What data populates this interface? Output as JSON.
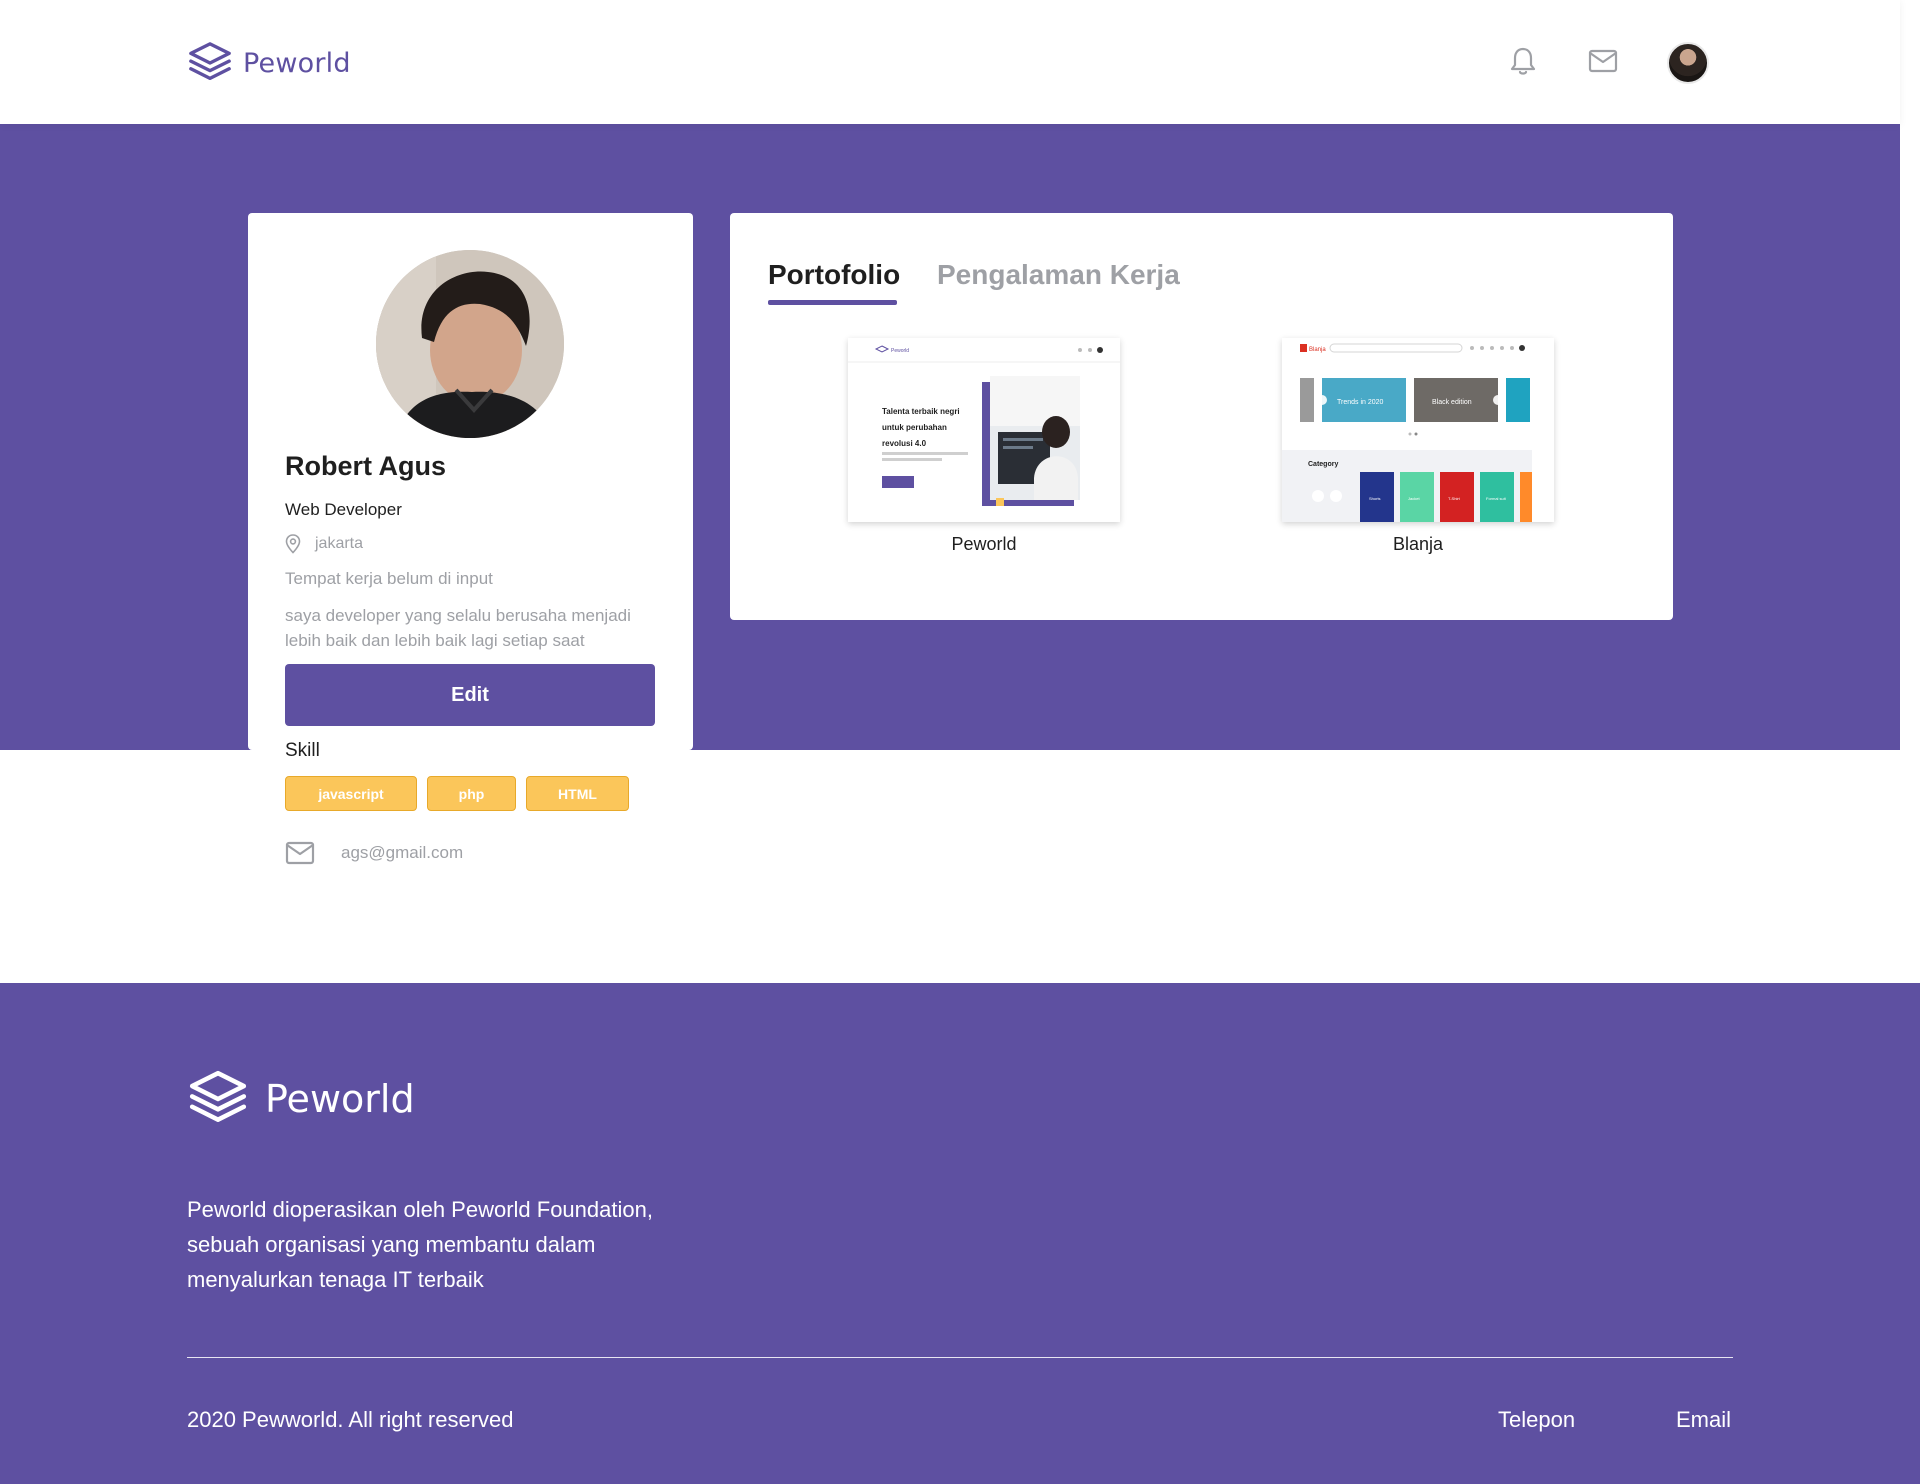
{
  "nav": {
    "brand": "Peworld",
    "icons": [
      "bell-icon",
      "mail-icon"
    ]
  },
  "profile": {
    "name": "Robert Agus",
    "job": "Web Developer",
    "location": "jakarta",
    "workplace": "Tempat kerja belum di input",
    "description": "saya developer yang selalu berusaha menjadi lebih baik dan lebih baik lagi setiap saat",
    "edit_label": "Edit",
    "skill_title": "Skill",
    "skills": [
      "javascript",
      "php",
      "HTML"
    ],
    "email": "ags@gmail.com"
  },
  "tabs": {
    "active": "Portofolio",
    "inactive": "Pengalaman Kerja"
  },
  "portfolio": [
    {
      "label": "Peworld",
      "preview": {
        "brand": "Peworld",
        "headline_1": "Talenta terbaik negri",
        "headline_2": "untuk perubahan",
        "headline_3": "revolusi 4.0"
      }
    },
    {
      "label": "Blanja",
      "preview": {
        "brand": "Blanja",
        "banner_1": "Trends in 2020",
        "banner_2": "Black edition",
        "category": "Category",
        "cat_1": "Shorts",
        "cat_2": "Jacket",
        "cat_3": "T-Shirt",
        "cat_4": "Formal suit"
      }
    }
  ],
  "footer": {
    "brand": "Peworld",
    "description": "Peworld dioperasikan oleh Peworld Foundation, sebuah organisasi yang membantu dalam menyalurkan tenaga IT terbaik",
    "copyright": "2020 Pewworld. All right reserved",
    "telepon": "Telepon",
    "email": "Email"
  },
  "colors": {
    "primary": "#5E50A1",
    "skill": "#FBC65A",
    "muted": "#9EA0A5"
  }
}
